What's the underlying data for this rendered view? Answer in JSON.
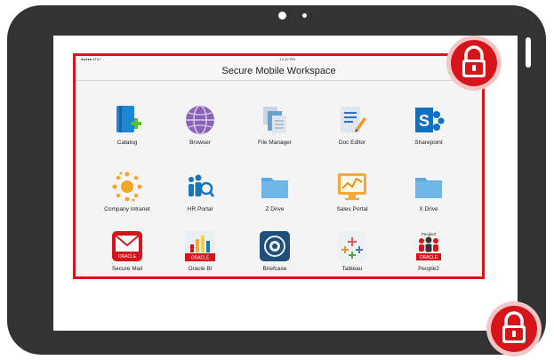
{
  "status": {
    "carrier": "●●●●● AT&T",
    "time": "12:10 PM"
  },
  "header": {
    "title": "Secure Mobile Workspace"
  },
  "apps": [
    {
      "label": "Catalog",
      "icon": "catalog-icon"
    },
    {
      "label": "Browser",
      "icon": "browser-icon"
    },
    {
      "label": "File Manager",
      "icon": "file-manager-icon"
    },
    {
      "label": "Doc Editor",
      "icon": "doc-editor-icon"
    },
    {
      "label": "Sharepoint",
      "icon": "sharepoint-icon"
    },
    {
      "label": "Company Intranet",
      "icon": "company-intranet-icon"
    },
    {
      "label": "HR Portal",
      "icon": "hr-portal-icon"
    },
    {
      "label": "Z Drive",
      "icon": "folder-icon"
    },
    {
      "label": "Sales Portal",
      "icon": "sales-portal-icon"
    },
    {
      "label": "X Drive",
      "icon": "folder-icon"
    },
    {
      "label": "Secure Mail",
      "icon": "secure-mail-icon",
      "badge": "ORACLE"
    },
    {
      "label": "Oracle BI",
      "icon": "oracle-bi-icon",
      "badge": "ORACLE"
    },
    {
      "label": "Briefcase",
      "icon": "briefcase-icon"
    },
    {
      "label": "Tableau",
      "icon": "tableau-icon"
    },
    {
      "label": "People2",
      "icon": "people2-icon",
      "badge": "ORACLE",
      "caption": "People2"
    }
  ],
  "colors": {
    "frame": "#333333",
    "border": "#d8141b",
    "lock": "#d8141b",
    "accent": "#1b75bb"
  }
}
